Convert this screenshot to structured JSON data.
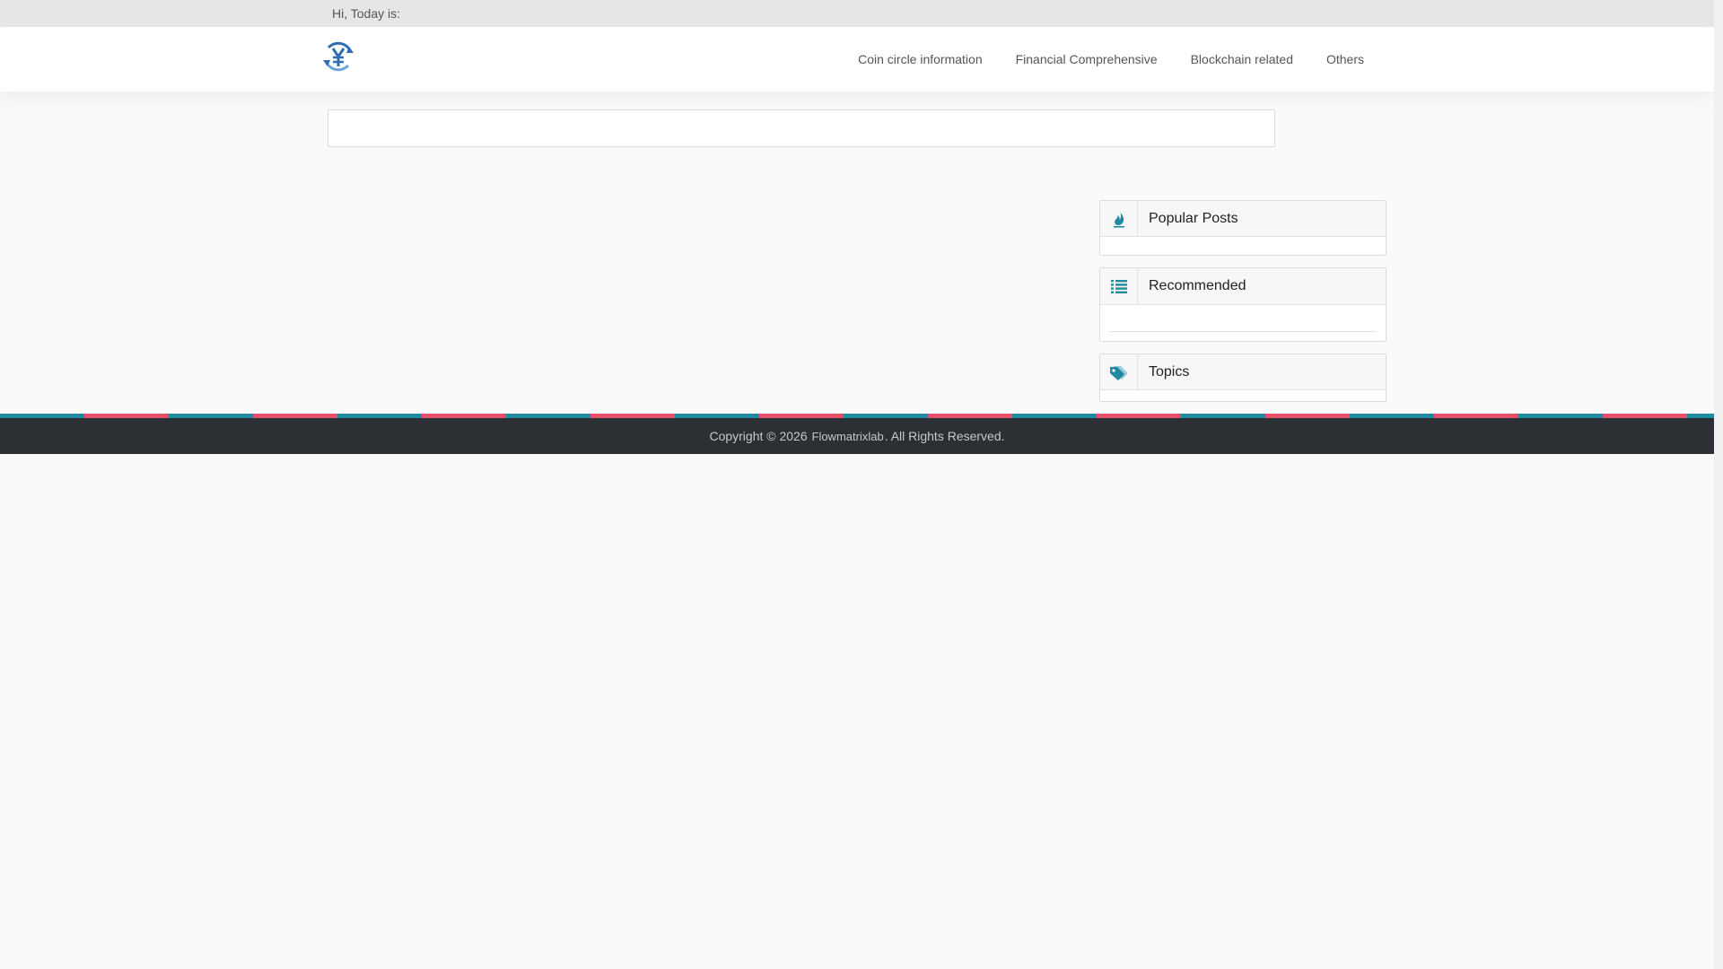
{
  "topbar": {
    "greeting": "Hi, Today is:"
  },
  "header": {
    "logo_icon": "yen-exchange-icon",
    "nav": [
      {
        "label": "Coin circle information"
      },
      {
        "label": "Financial Comprehensive"
      },
      {
        "label": "Blockchain related"
      },
      {
        "label": "Others"
      }
    ]
  },
  "search": {
    "placeholder": ""
  },
  "sidebar": {
    "popular": {
      "title": "Popular Posts",
      "icon": "flame-icon"
    },
    "recommended": {
      "title": "Recommended",
      "icon": "list-icon"
    },
    "topics": {
      "title": "Topics",
      "icon": "tags-icon"
    }
  },
  "footer": {
    "prefix": "Copyright © 2026",
    "brand": "Flowmatrixlab",
    "suffix": ". All Rights Reserved."
  },
  "colors": {
    "accent_teal": "#1f8aa0",
    "accent_pink": "#e8506a",
    "footer_bg": "#2c2f33",
    "logo_blue": "#2f6db5"
  }
}
